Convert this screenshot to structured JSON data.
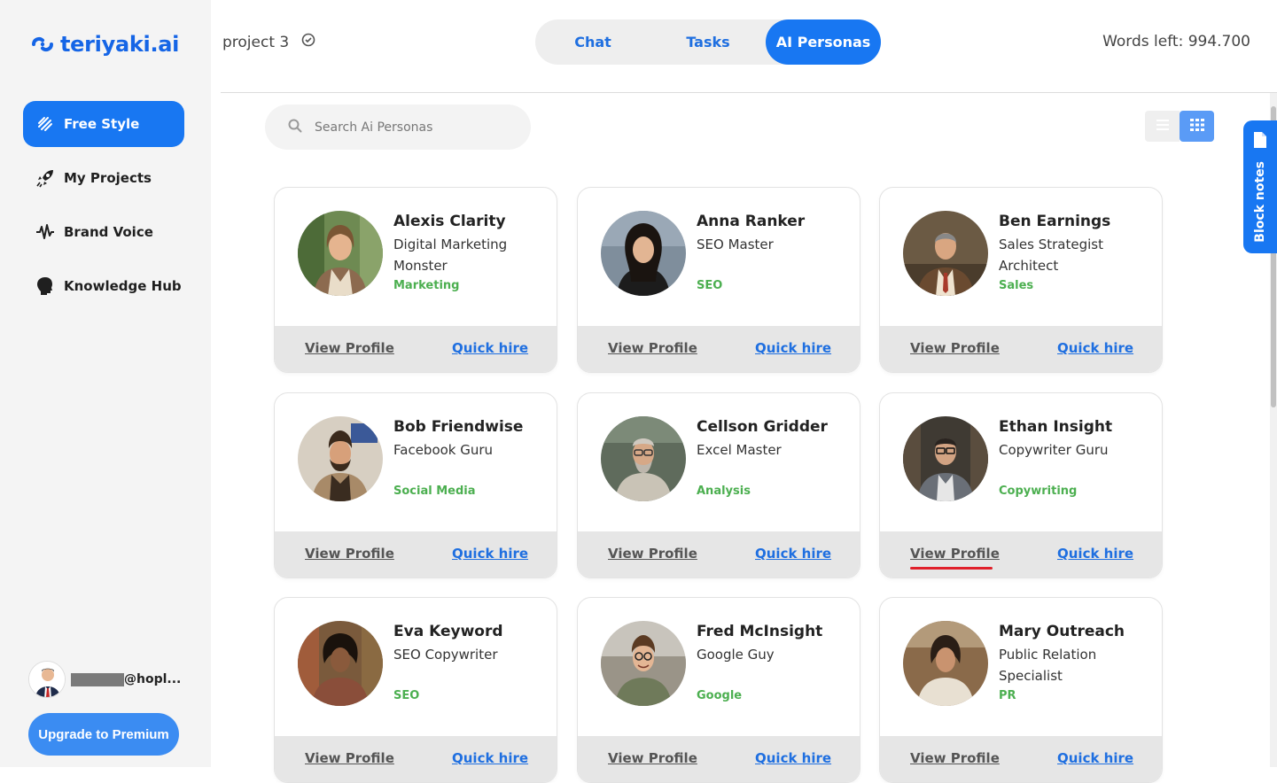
{
  "brand": {
    "name": "teriyaki.ai",
    "accent": "#1877f2"
  },
  "sidebar": {
    "items": [
      {
        "label": "Free Style",
        "icon": "brush-icon",
        "active": true
      },
      {
        "label": "My Projects",
        "icon": "rocket-icon",
        "active": false
      },
      {
        "label": "Brand Voice",
        "icon": "waveform-icon",
        "active": false
      },
      {
        "label": "Knowledge Hub",
        "icon": "head-icon",
        "active": false
      }
    ],
    "user_email": "@hopl...",
    "upgrade_label": "Upgrade to Premium"
  },
  "header": {
    "project_name": "project 3",
    "tabs": [
      {
        "label": "Chat",
        "active": false
      },
      {
        "label": "Tasks",
        "active": false
      },
      {
        "label": "AI Personas",
        "active": true
      }
    ],
    "words_left": "Words left: 994.700"
  },
  "search": {
    "placeholder": "Search Ai Personas"
  },
  "block_notes_label": "Block notes",
  "card_actions": {
    "view": "View Profile",
    "hire": "Quick hire"
  },
  "personas": [
    {
      "name": "Alexis Clarity",
      "role": "Digital Marketing Monster",
      "tag": "Marketing"
    },
    {
      "name": "Anna Ranker",
      "role": "SEO Master",
      "tag": "SEO"
    },
    {
      "name": "Ben Earnings",
      "role": "Sales Strategist Architect",
      "tag": "Sales"
    },
    {
      "name": "Bob Friendwise",
      "role": "Facebook Guru",
      "tag": "Social Media"
    },
    {
      "name": "Cellson Gridder",
      "role": "Excel Master",
      "tag": "Analysis"
    },
    {
      "name": "Ethan Insight",
      "role": "Copywriter Guru",
      "tag": "Copywriting"
    },
    {
      "name": "Eva Keyword",
      "role": "SEO Copywriter",
      "tag": "SEO"
    },
    {
      "name": "Fred McInsight",
      "role": "Google Guy",
      "tag": "Google"
    },
    {
      "name": "Mary Outreach",
      "role": "Public Relation Specialist",
      "tag": "PR"
    }
  ]
}
